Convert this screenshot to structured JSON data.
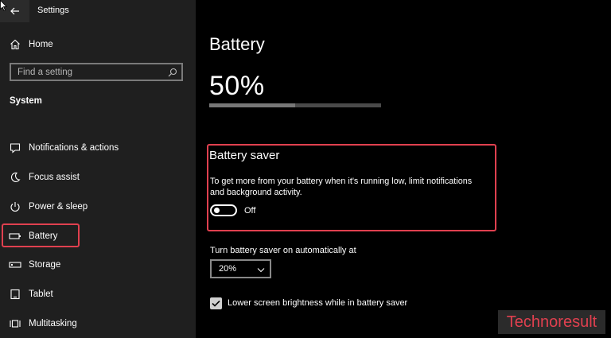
{
  "window": {
    "title": "Settings"
  },
  "sidebar": {
    "home_label": "Home",
    "search": {
      "placeholder": "Find a setting",
      "value": ""
    },
    "section_title": "System",
    "items": [
      {
        "label": "Notifications & actions",
        "icon": "notification-icon"
      },
      {
        "label": "Focus assist",
        "icon": "moon-icon"
      },
      {
        "label": "Power & sleep",
        "icon": "power-icon"
      },
      {
        "label": "Battery",
        "icon": "battery-icon",
        "selected": true
      },
      {
        "label": "Storage",
        "icon": "storage-icon"
      },
      {
        "label": "Tablet",
        "icon": "tablet-icon"
      },
      {
        "label": "Multitasking",
        "icon": "multitasking-icon"
      }
    ]
  },
  "main": {
    "title": "Battery",
    "percent_text": "50%",
    "percent_value": 0.5,
    "battery_saver": {
      "title": "Battery saver",
      "description": "To get more from your battery when it's running low, limit notifications and background activity.",
      "toggle_state": "Off"
    },
    "auto_on": {
      "label": "Turn battery saver on automatically at",
      "selected": "20%"
    },
    "lower_brightness": {
      "label": "Lower screen brightness while in battery saver",
      "checked": true
    }
  },
  "watermark": "Technoresult",
  "colors": {
    "highlight": "#e0404f",
    "sidebar_bg": "#1f1f1f",
    "bg": "#000000"
  }
}
